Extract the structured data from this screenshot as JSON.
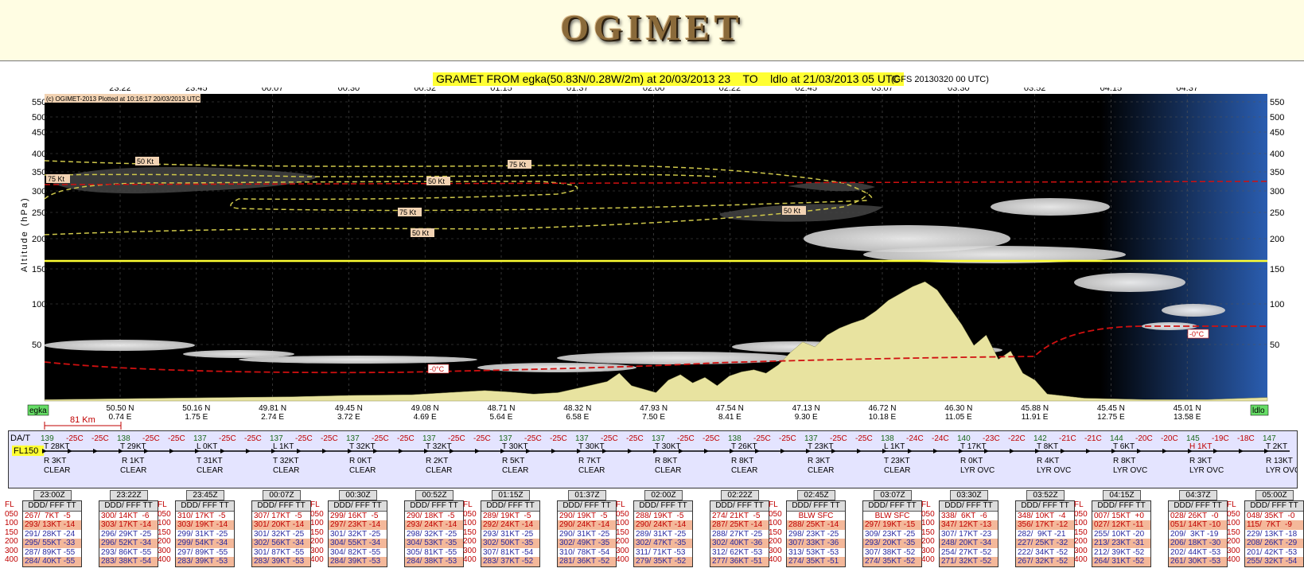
{
  "banner": {
    "logo": "OGIMET"
  },
  "title": "GRAMET FROM egka(50.83N/0.28W/2m) at 20/03/2013 23    TO    ldlo at 21/03/2013 05 UTC",
  "gfs_note": "(GFS 20130320 00 UTC)",
  "copyright": "(c) OGIMET-2013 Plotted at 10:16:17 20/03/2013 UTC",
  "scale_label": "81 Km",
  "colors": {
    "plot_bg": "#000000",
    "terrain": "#e8e3a0",
    "cloud": "#f2f2f2",
    "jet": "#cfc84a",
    "freezing": "#d01010",
    "fl_line": "#ffff33",
    "accent_red": "#c00000",
    "accent_blue": "#2a2aa0"
  },
  "chart_data": {
    "type": "area",
    "ylabel": "Altitude (hPa)",
    "y_ticks": [
      550,
      500,
      450,
      400,
      350,
      300,
      250,
      200,
      150,
      100,
      50
    ],
    "time_ticks": [
      "23:22",
      "23:45",
      "00:07",
      "00:30",
      "00:52",
      "01:15",
      "01:37",
      "02:00",
      "02:22",
      "02:45",
      "03:07",
      "03:30",
      "03:52",
      "04:15",
      "04:37"
    ],
    "positions": [
      {
        "lat": "50.50 N",
        "lon": "0.74 E"
      },
      {
        "lat": "50.16 N",
        "lon": "1.75 E"
      },
      {
        "lat": "49.81 N",
        "lon": "2.74 E"
      },
      {
        "lat": "49.45 N",
        "lon": "3.72 E"
      },
      {
        "lat": "49.08 N",
        "lon": "4.69 E"
      },
      {
        "lat": "48.71 N",
        "lon": "5.64 E"
      },
      {
        "lat": "48.32 N",
        "lon": "6.58 E"
      },
      {
        "lat": "47.93 N",
        "lon": "7.50 E"
      },
      {
        "lat": "47.54 N",
        "lon": "8.41 E"
      },
      {
        "lat": "47.13 N",
        "lon": "9.30 E"
      },
      {
        "lat": "46.72 N",
        "lon": "10.18 E"
      },
      {
        "lat": "46.30 N",
        "lon": "11.05 E"
      },
      {
        "lat": "45.88 N",
        "lon": "11.91 E"
      },
      {
        "lat": "45.45 N",
        "lon": "12.75 E"
      },
      {
        "lat": "45.01 N",
        "lon": "13.58 E"
      }
    ],
    "start_station": "egka",
    "end_station": "ldlo",
    "wind_labels": [
      "50 Kt",
      "75 Kt",
      "50 Kt",
      "75 Kt",
      "75 Kt",
      "50 Kt",
      "50 Kt"
    ],
    "freezing_labels": [
      "-0°C",
      "-0°C"
    ],
    "terrain_profile": [
      [
        0,
        0.02
      ],
      [
        0.05,
        0.03
      ],
      [
        0.1,
        0.04
      ],
      [
        0.15,
        0.05
      ],
      [
        0.2,
        0.06
      ],
      [
        0.25,
        0.08
      ],
      [
        0.3,
        0.09
      ],
      [
        0.33,
        0.12
      ],
      [
        0.36,
        0.15
      ],
      [
        0.38,
        0.13
      ],
      [
        0.4,
        0.1
      ],
      [
        0.42,
        0.12
      ],
      [
        0.44,
        0.2
      ],
      [
        0.46,
        0.28
      ],
      [
        0.47,
        0.4
      ],
      [
        0.48,
        0.22
      ],
      [
        0.5,
        0.12
      ],
      [
        0.51,
        0.3
      ],
      [
        0.52,
        0.38
      ],
      [
        0.53,
        0.26
      ],
      [
        0.54,
        0.34
      ],
      [
        0.55,
        0.22
      ],
      [
        0.56,
        0.36
      ],
      [
        0.57,
        0.42
      ],
      [
        0.58,
        0.45
      ],
      [
        0.59,
        0.4
      ],
      [
        0.6,
        0.52
      ],
      [
        0.61,
        0.7
      ],
      [
        0.62,
        0.85
      ],
      [
        0.63,
        0.78
      ],
      [
        0.64,
        0.95
      ],
      [
        0.65,
        1.05
      ],
      [
        0.66,
        1.12
      ],
      [
        0.67,
        1.18
      ],
      [
        0.68,
        1.3
      ],
      [
        0.69,
        1.45
      ],
      [
        0.7,
        1.55
      ],
      [
        0.71,
        1.65
      ],
      [
        0.72,
        1.72
      ],
      [
        0.73,
        1.6
      ],
      [
        0.74,
        1.35
      ],
      [
        0.75,
        1.1
      ],
      [
        0.76,
        0.8
      ],
      [
        0.77,
        0.95
      ],
      [
        0.78,
        0.6
      ],
      [
        0.79,
        0.72
      ],
      [
        0.8,
        0.4
      ],
      [
        0.81,
        0.3
      ],
      [
        0.82,
        0.1
      ],
      [
        0.85,
        0.04
      ],
      [
        0.9,
        0.02
      ],
      [
        0.95,
        0.02
      ],
      [
        1.0,
        0.05
      ]
    ]
  },
  "panel": {
    "head": "DA/T",
    "fl_tag": "FL150",
    "temps": [
      "139",
      "-25C",
      "-25C",
      "138",
      "-25C",
      "-25C",
      "137",
      "-25C",
      "-25C",
      "137",
      "-25C",
      "-25C",
      "137",
      "-25C",
      "-25C",
      "137",
      "-25C",
      "-25C",
      "137",
      "-25C",
      "-25C",
      "137",
      "-25C",
      "-25C",
      "137",
      "-25C",
      "-25C",
      "138",
      "-25C",
      "-25C",
      "137",
      "-25C",
      "-25C",
      "138",
      "-24C",
      "-24C",
      "140",
      "-23C",
      "-22C",
      "142",
      "-21C",
      "-21C",
      "144",
      "-20C",
      "-20C",
      "145",
      "-19C",
      "-18C",
      "147"
    ],
    "legs": [
      {
        "top": "T 28KT",
        "mid": "R 3KT",
        "bot": "CLEAR"
      },
      {
        "top": "R 1KT",
        "mid": "",
        "bot": "CLEAR",
        "alt": "T 29KT"
      },
      {
        "top": "L 0KT",
        "mid": "T 31KT",
        "bot": "CLEAR"
      },
      {
        "top": "L 1KT",
        "mid": "T 32KT",
        "bot": "CLEAR"
      },
      {
        "top": "T 32KT",
        "mid": "R 0KT",
        "bot": "CLEAR"
      },
      {
        "top": "T 32KT",
        "mid": "R 2KT",
        "bot": "CLEAR"
      },
      {
        "top": "T 30KT",
        "mid": "R 5KT",
        "bot": "CLEAR"
      },
      {
        "top": "T 30KT",
        "mid": "R 7KT",
        "bot": "CLEAR"
      },
      {
        "top": "T 30KT",
        "mid": "R 8KT",
        "bot": "CLEAR"
      },
      {
        "top": "T 26KT",
        "mid": "R 8KT",
        "bot": "CLEAR"
      },
      {
        "top": "T 23KT",
        "mid": "R 3KT",
        "bot": "CLEAR"
      },
      {
        "top": "L 1KT",
        "mid": "T 23KT",
        "bot": "CLEAR"
      },
      {
        "top": "T 17KT",
        "mid": "R 0KT",
        "bot": "LYR OVC"
      },
      {
        "top": "T 8KT",
        "mid": "R 4KT",
        "bot": "LYR OVC"
      },
      {
        "top": "T 6KT",
        "mid": "R 8KT",
        "bot": "LYR OVC"
      },
      {
        "top": "H 1KT",
        "mid": "R 3KT",
        "bot": "LYR OVC"
      },
      {
        "top": "T 2KT",
        "mid": "R 13KT",
        "bot": "LYR OVC"
      }
    ]
  },
  "stations_header": "DDD/ FFF TT",
  "fl_levels": [
    "FL",
    "050",
    "100",
    "150",
    "200",
    "300",
    "400"
  ],
  "stations": [
    {
      "time": "23:00Z",
      "rows": [
        "267/  7KT  -5",
        "293/ 13KT -14",
        "291/ 28KT -24",
        "295/ 55KT -33",
        "287/ 89KT -55",
        "284/ 40KT -55"
      ]
    },
    {
      "time": "23:22Z",
      "rows": [
        "300/ 14KT  -6",
        "303/ 17KT -14",
        "296/ 29KT -25",
        "296/ 52KT -34",
        "293/ 86KT -55",
        "283/ 38KT -54"
      ]
    },
    {
      "time": "23:45Z",
      "rows": [
        "310/ 17KT  -5",
        "303/ 19KT -14",
        "299/ 31KT -25",
        "299/ 54KT -34",
        "297/ 89KT -55",
        "283/ 39KT -53"
      ]
    },
    {
      "time": "00:07Z",
      "rows": [
        "307/ 17KT  -5",
        "301/ 20KT -14",
        "301/ 32KT -25",
        "302/ 56KT -34",
        "301/ 87KT -55",
        "283/ 39KT -53"
      ]
    },
    {
      "time": "00:30Z",
      "rows": [
        "299/ 16KT  -5",
        "297/ 23KT -14",
        "301/ 32KT -25",
        "304/ 55KT -34",
        "304/ 82KT -55",
        "284/ 39KT -53"
      ]
    },
    {
      "time": "00:52Z",
      "rows": [
        "290/ 18KT  -5",
        "293/ 24KT -14",
        "298/ 32KT -25",
        "304/ 53KT -35",
        "305/ 81KT -55",
        "284/ 38KT -53"
      ]
    },
    {
      "time": "01:15Z",
      "rows": [
        "289/ 19KT  -5",
        "292/ 24KT -14",
        "293/ 31KT -25",
        "302/ 50KT -35",
        "307/ 81KT -54",
        "283/ 37KT -52"
      ]
    },
    {
      "time": "01:37Z",
      "rows": [
        "290/ 19KT  -5",
        "290/ 24KT -14",
        "290/ 31KT -25",
        "302/ 49KT -35",
        "310/ 78KT -54",
        "281/ 36KT -52"
      ]
    },
    {
      "time": "02:00Z",
      "rows": [
        "288/ 19KT  -5",
        "290/ 24KT -14",
        "289/ 31KT -25",
        "302/ 47KT -35",
        "311/ 71KT -53",
        "279/ 35KT -52"
      ]
    },
    {
      "time": "02:22Z",
      "rows": [
        "274/ 21KT  -5",
        "287/ 25KT -14",
        "288/ 27KT -25",
        "302/ 40KT -36",
        "312/ 62KT -53",
        "277/ 36KT -51"
      ]
    },
    {
      "time": "02:45Z",
      "rows": [
        "BLW SFC",
        "288/ 25KT -14",
        "298/ 23KT -25",
        "307/ 33KT -36",
        "313/ 53KT -53",
        "274/ 35KT -51"
      ]
    },
    {
      "time": "03:07Z",
      "rows": [
        "BLW SFC",
        "297/ 19KT -15",
        "309/ 23KT -25",
        "293/ 20KT -35",
        "307/ 38KT -52",
        "274/ 35KT -52"
      ]
    },
    {
      "time": "03:30Z",
      "rows": [
        "338/  6KT  -6",
        "347/ 12KT -13",
        "307/ 17KT -23",
        "248/ 20KT -34",
        "254/ 27KT -52",
        "271/ 32KT -52"
      ]
    },
    {
      "time": "03:52Z",
      "rows": [
        "348/ 10KT  -4",
        "356/ 17KT -12",
        "282/  9KT -21",
        "227/ 25KT -32",
        "222/ 34KT -52",
        "267/ 32KT -52"
      ]
    },
    {
      "time": "04:15Z",
      "rows": [
        "007/ 15KT  +0",
        "027/ 12KT -11",
        "255/ 10KT -20",
        "213/ 23KT -31",
        "212/ 39KT -52",
        "264/ 31KT -52"
      ]
    },
    {
      "time": "04:37Z",
      "rows": [
        "028/ 26KT  -0",
        "051/ 14KT -10",
        "209/  3KT -19",
        "206/ 18KT -30",
        "202/ 44KT -53",
        "261/ 30KT -53"
      ]
    },
    {
      "time": "05:00Z",
      "rows": [
        "048/ 35KT  -0",
        "115/  7KT  -9",
        "229/ 13KT -18",
        "208/ 26KT -29",
        "201/ 42KT -53",
        "255/ 32KT -54"
      ]
    }
  ]
}
